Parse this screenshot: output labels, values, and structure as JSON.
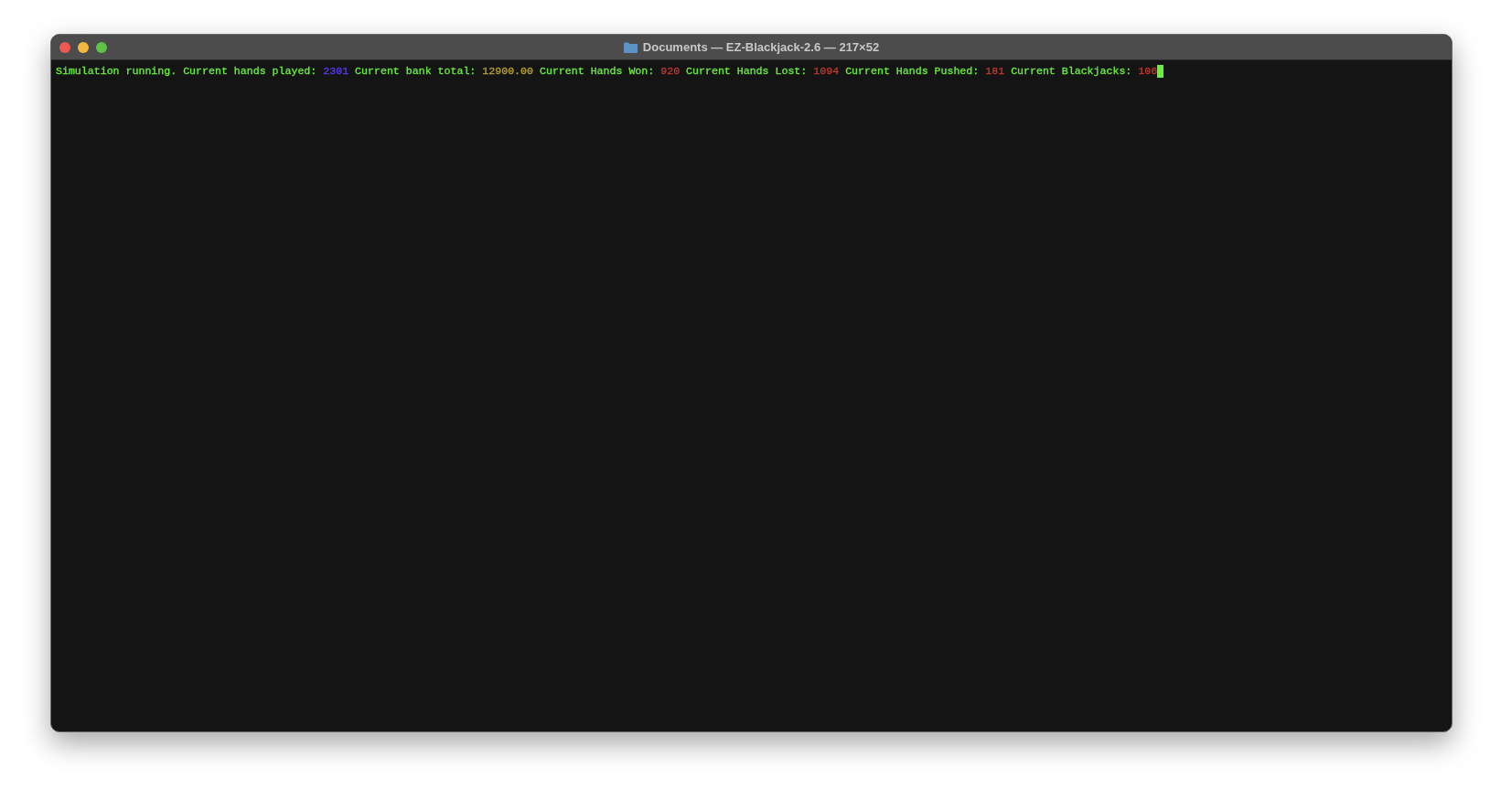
{
  "window": {
    "title": "Documents — EZ-Blackjack-2.6 — 217×52"
  },
  "terminal": {
    "segments": [
      {
        "text": "Simulation running. Current hands played:",
        "color": "#6af03c"
      },
      {
        "text": "2301",
        "color": "#5a3cf0"
      },
      {
        "text": "Current bank total:",
        "color": "#6af03c"
      },
      {
        "text": "12900.00",
        "color": "#b8a22e"
      },
      {
        "text": "Current Hands Won:",
        "color": "#6af03c"
      },
      {
        "text": "920",
        "color": "#c2392e"
      },
      {
        "text": "Current Hands Lost:",
        "color": "#6af03c"
      },
      {
        "text": "1094",
        "color": "#c2392e"
      },
      {
        "text": "Current Hands Pushed:",
        "color": "#6af03c"
      },
      {
        "text": "181",
        "color": "#c2392e"
      },
      {
        "text": "Current Blackjacks:",
        "color": "#6af03c"
      },
      {
        "text": "106",
        "color": "#c2392e"
      }
    ]
  }
}
